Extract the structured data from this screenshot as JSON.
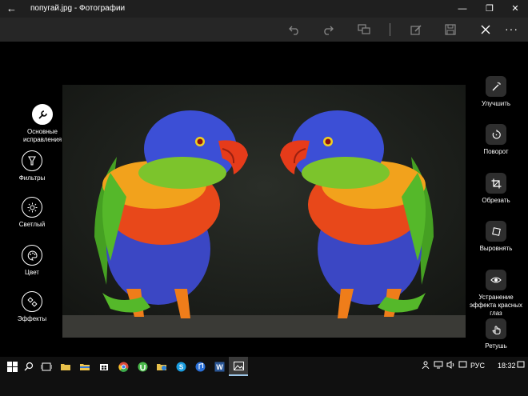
{
  "window": {
    "title": "попугай.jpg - Фотографии",
    "back_icon": "back-arrow-icon",
    "minimize": "—",
    "maximize": "❐",
    "close": "✕"
  },
  "toolbar": {
    "items": [
      "undo-icon",
      "redo-icon",
      "compare-icon",
      "edit-icon",
      "save-icon",
      "close-icon"
    ],
    "more_label": "···"
  },
  "left_tools": [
    {
      "label": "Основные исправления",
      "icon": "wrench-icon",
      "active": true
    },
    {
      "label": "Фильтры",
      "icon": "filter-icon",
      "active": false
    },
    {
      "label": "Светлый",
      "icon": "sun-icon",
      "active": false
    },
    {
      "label": "Цвет",
      "icon": "palette-icon",
      "active": false
    },
    {
      "label": "Эффекты",
      "icon": "effects-icon",
      "active": false
    }
  ],
  "right_tools": [
    {
      "label": "Улучшить",
      "icon": "magic-wand-icon"
    },
    {
      "label": "Поворот",
      "icon": "rotate-icon"
    },
    {
      "label": "Обрезать",
      "icon": "crop-icon"
    },
    {
      "label": "Выровнять",
      "icon": "straighten-icon"
    },
    {
      "label": "Устранение эффекта красных глаз",
      "icon": "eye-icon"
    },
    {
      "label": "Ретушь",
      "icon": "retouch-hand-icon"
    }
  ],
  "taskbar": {
    "language": "РУС",
    "time": "18:32",
    "icons": [
      "windows-start-icon",
      "search-icon",
      "task-view-icon",
      "folder-icon",
      "file-explorer-icon",
      "store-icon",
      "chrome-icon",
      "utorrent-icon",
      "explorer-icon",
      "skype-icon",
      "music-icon",
      "word-icon",
      "photos-icon"
    ]
  },
  "colors": {
    "accent": "#9ec7e8",
    "background": "#000000",
    "toolbar": "#262626"
  }
}
